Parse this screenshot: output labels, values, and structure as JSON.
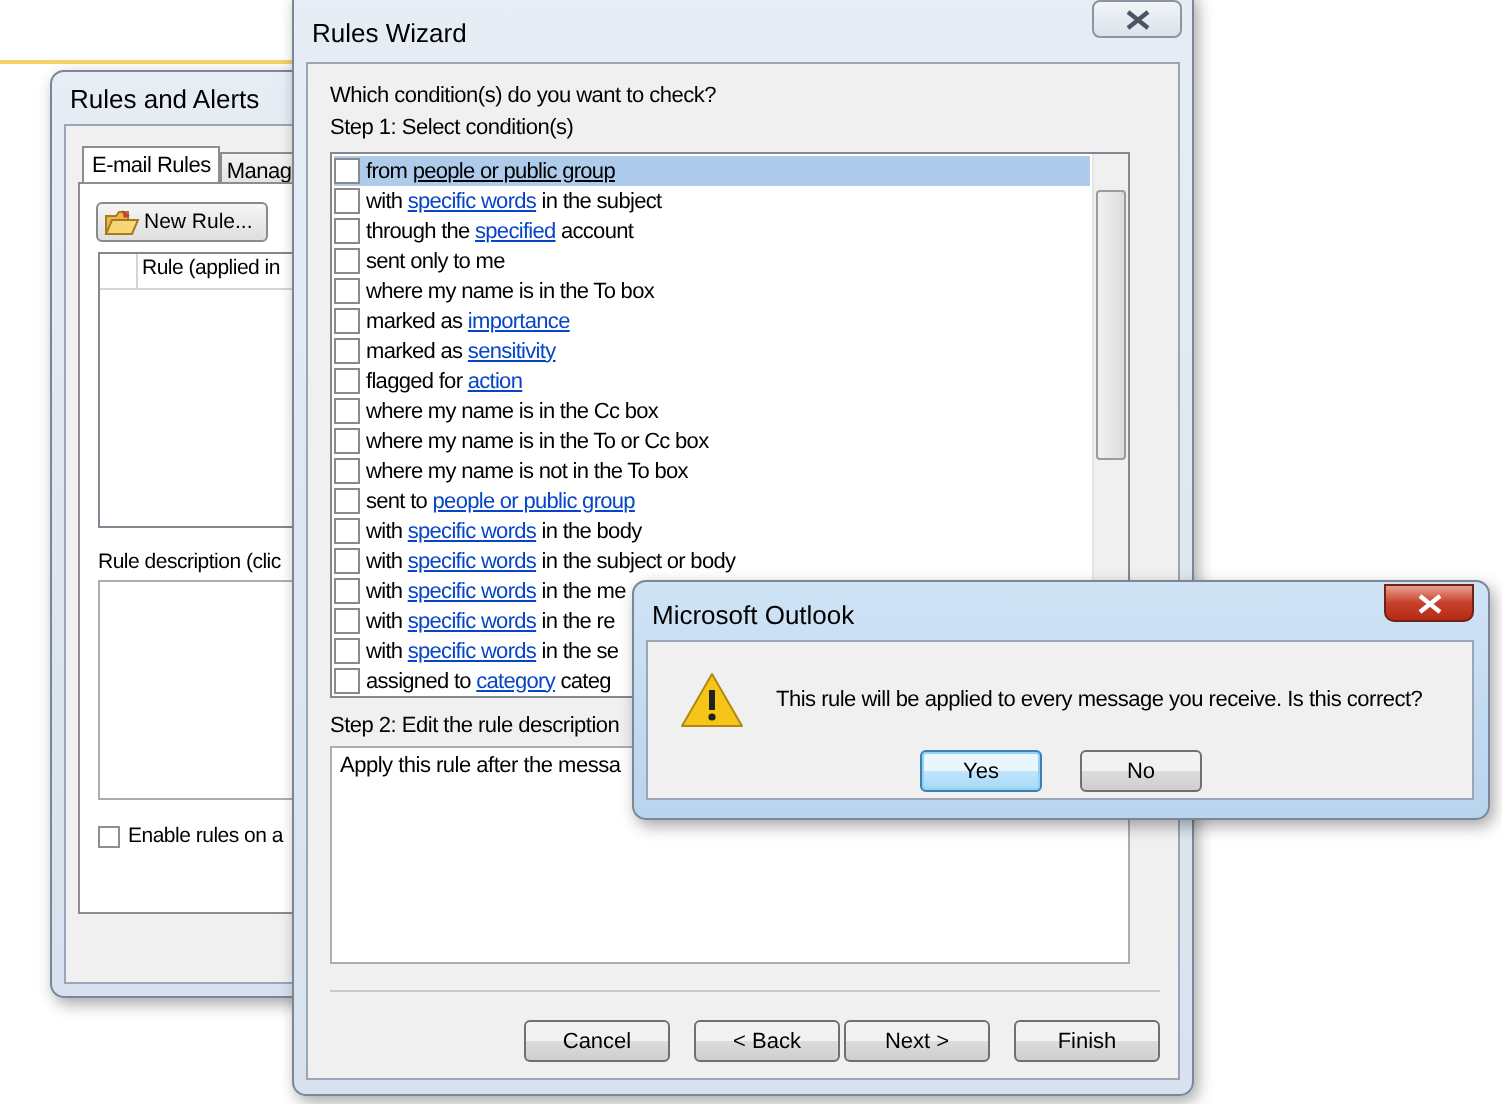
{
  "rules_and_alerts": {
    "title": "Rules and Alerts",
    "tabs": [
      {
        "label": "E-mail Rules",
        "selected": true
      },
      {
        "label": "Manag",
        "selected": false
      }
    ],
    "new_rule_button": "New Rule...",
    "rule_list": {
      "columns": [
        "Rule (applied in"
      ]
    },
    "description_label": "Rule description (clic",
    "enable_checkbox": {
      "label": "Enable rules on a",
      "checked": false
    }
  },
  "rules_wizard": {
    "title": "Rules Wizard",
    "question": "Which condition(s) do you want to check?",
    "step1_label": "Step 1: Select condition(s)",
    "conditions": [
      {
        "selected": true,
        "checked": false,
        "parts": [
          {
            "kind": "plain",
            "text": "from "
          },
          {
            "kind": "link",
            "text": "people or public group"
          }
        ]
      },
      {
        "selected": false,
        "checked": false,
        "parts": [
          {
            "kind": "plain",
            "text": "with "
          },
          {
            "kind": "link",
            "text": "specific words"
          },
          {
            "kind": "plain",
            "text": " in the subject"
          }
        ]
      },
      {
        "selected": false,
        "checked": false,
        "parts": [
          {
            "kind": "plain",
            "text": "through the "
          },
          {
            "kind": "link",
            "text": "specified"
          },
          {
            "kind": "plain",
            "text": " account"
          }
        ]
      },
      {
        "selected": false,
        "checked": false,
        "parts": [
          {
            "kind": "plain",
            "text": "sent only to me"
          }
        ]
      },
      {
        "selected": false,
        "checked": false,
        "parts": [
          {
            "kind": "plain",
            "text": "where my name is in the To box"
          }
        ]
      },
      {
        "selected": false,
        "checked": false,
        "parts": [
          {
            "kind": "plain",
            "text": "marked as "
          },
          {
            "kind": "link",
            "text": "importance"
          }
        ]
      },
      {
        "selected": false,
        "checked": false,
        "parts": [
          {
            "kind": "plain",
            "text": "marked as "
          },
          {
            "kind": "link",
            "text": "sensitivity"
          }
        ]
      },
      {
        "selected": false,
        "checked": false,
        "parts": [
          {
            "kind": "plain",
            "text": "flagged for "
          },
          {
            "kind": "link",
            "text": "action"
          }
        ]
      },
      {
        "selected": false,
        "checked": false,
        "parts": [
          {
            "kind": "plain",
            "text": "where my name is in the Cc box"
          }
        ]
      },
      {
        "selected": false,
        "checked": false,
        "parts": [
          {
            "kind": "plain",
            "text": "where my name is in the To or Cc box"
          }
        ]
      },
      {
        "selected": false,
        "checked": false,
        "parts": [
          {
            "kind": "plain",
            "text": "where my name is not in the To box"
          }
        ]
      },
      {
        "selected": false,
        "checked": false,
        "parts": [
          {
            "kind": "plain",
            "text": "sent to "
          },
          {
            "kind": "link",
            "text": "people or public group"
          }
        ]
      },
      {
        "selected": false,
        "checked": false,
        "parts": [
          {
            "kind": "plain",
            "text": "with "
          },
          {
            "kind": "link",
            "text": "specific words"
          },
          {
            "kind": "plain",
            "text": " in the body"
          }
        ]
      },
      {
        "selected": false,
        "checked": false,
        "parts": [
          {
            "kind": "plain",
            "text": "with "
          },
          {
            "kind": "link",
            "text": "specific words"
          },
          {
            "kind": "plain",
            "text": " in the subject or body"
          }
        ]
      },
      {
        "selected": false,
        "checked": false,
        "parts": [
          {
            "kind": "plain",
            "text": "with "
          },
          {
            "kind": "link",
            "text": "specific words"
          },
          {
            "kind": "plain",
            "text": " in the me"
          }
        ]
      },
      {
        "selected": false,
        "checked": false,
        "parts": [
          {
            "kind": "plain",
            "text": "with "
          },
          {
            "kind": "link",
            "text": "specific words"
          },
          {
            "kind": "plain",
            "text": " in the re"
          }
        ]
      },
      {
        "selected": false,
        "checked": false,
        "parts": [
          {
            "kind": "plain",
            "text": "with "
          },
          {
            "kind": "link",
            "text": "specific words"
          },
          {
            "kind": "plain",
            "text": " in the se"
          }
        ]
      },
      {
        "selected": false,
        "checked": false,
        "parts": [
          {
            "kind": "plain",
            "text": "assigned to "
          },
          {
            "kind": "link",
            "text": "category"
          },
          {
            "kind": "plain",
            "text": " categ"
          }
        ]
      }
    ],
    "step2_label": "Step 2: Edit the rule description",
    "description": "Apply this rule after the messa",
    "buttons": [
      "Cancel",
      "< Back",
      "Next >",
      "Finish"
    ]
  },
  "dialog": {
    "title": "Microsoft Outlook",
    "message": "This rule will be applied to every message you receive. Is this correct?",
    "buttons": [
      {
        "label": "Yes",
        "default": true
      },
      {
        "label": "No",
        "default": false
      }
    ]
  }
}
